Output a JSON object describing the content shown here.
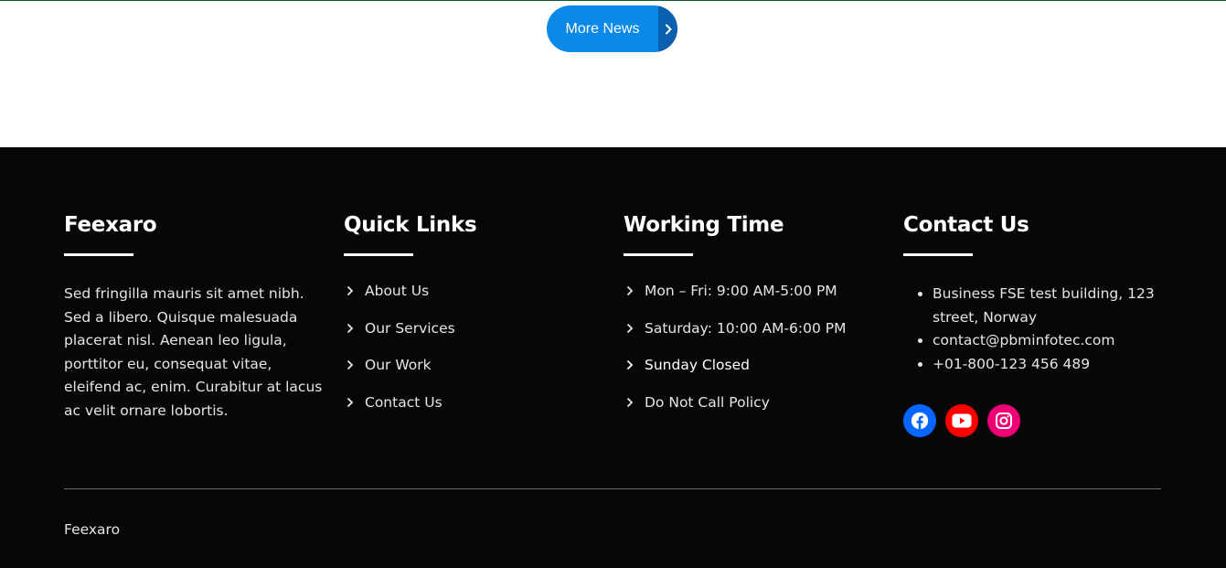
{
  "top": {
    "more_news_label": "More News"
  },
  "footer": {
    "brand": {
      "title": "Feexaro",
      "text": "Sed fringilla mauris sit amet nibh. Sed a libero. Quisque malesuada placerat nisl. Aenean leo ligula, porttitor eu, consequat vitae, eleifend ac, enim. Curabitur at lacus ac velit ornare lobortis."
    },
    "quick_links": {
      "title": "Quick Links",
      "items": [
        "About Us",
        "Our Services",
        "Our Work",
        "Contact Us"
      ]
    },
    "working_time": {
      "title": "Working Time",
      "items": [
        "Mon – Fri: 9:00 AM-5:00 PM",
        "Saturday: 10:00 AM-6:00 PM",
        "Sunday Closed",
        "Do Not Call Policy"
      ]
    },
    "contact": {
      "title": "Contact Us",
      "items": [
        "Business FSE test building, 123 street, Norway",
        "contact@pbminfotec.com",
        "+01-800-123 456 489"
      ]
    },
    "social": [
      {
        "icon": "facebook-icon",
        "color": "#0866ff"
      },
      {
        "icon": "youtube-icon",
        "color": "#ff0000"
      },
      {
        "icon": "instagram-icon",
        "color": "#f00075"
      }
    ],
    "copyright": "Feexaro"
  },
  "colors": {
    "button_primary": "#0b89e9",
    "button_arrow": "#0a5fae",
    "footer_bg": "#070707"
  }
}
